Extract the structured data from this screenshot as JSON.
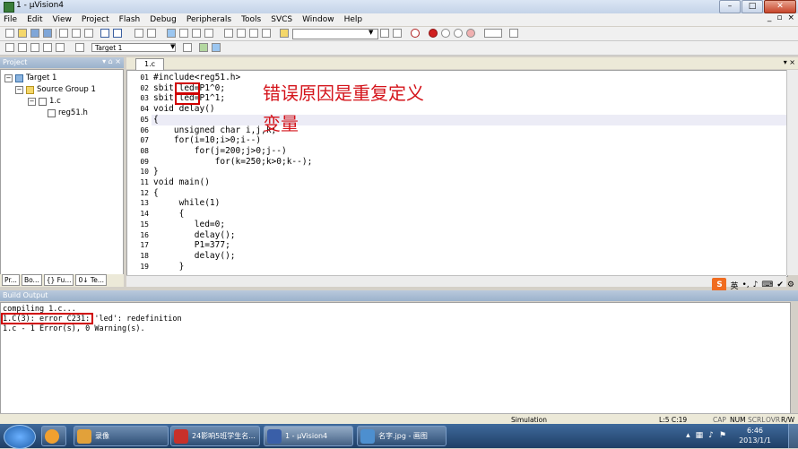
{
  "window": {
    "title": "1 - µVision4"
  },
  "menu": [
    "File",
    "Edit",
    "View",
    "Project",
    "Flash",
    "Debug",
    "Peripherals",
    "Tools",
    "SVCS",
    "Window",
    "Help"
  ],
  "toolbar": {
    "target": "Target 1"
  },
  "project_panel": {
    "title": "Project",
    "tree": {
      "target": "Target 1",
      "group": "Source Group 1",
      "file": "1.c",
      "header": "reg51.h"
    },
    "tabs": [
      "Pr...",
      "Bo...",
      "{} Fu...",
      "0↓ Te..."
    ]
  },
  "editor": {
    "tab": "1.c",
    "lines": [
      {
        "n": "01",
        "t": "#include<reg51.h>"
      },
      {
        "n": "02",
        "t": "sbit led=P1^0;"
      },
      {
        "n": "03",
        "t": "sbit led=P1^1;"
      },
      {
        "n": "04",
        "t": "void delay()"
      },
      {
        "n": "05",
        "t": "{"
      },
      {
        "n": "06",
        "t": "    unsigned char i,j,k;"
      },
      {
        "n": "07",
        "t": "    for(i=10;i>0;i--)"
      },
      {
        "n": "08",
        "t": "        for(j=200;j>0;j--)"
      },
      {
        "n": "09",
        "t": "            for(k=250;k>0;k--);"
      },
      {
        "n": "10",
        "t": "}"
      },
      {
        "n": "11",
        "t": "void main()"
      },
      {
        "n": "12",
        "t": "{"
      },
      {
        "n": "13",
        "t": "     while(1)"
      },
      {
        "n": "14",
        "t": "     {"
      },
      {
        "n": "15",
        "t": "        led=0;"
      },
      {
        "n": "16",
        "t": "        delay();"
      },
      {
        "n": "17",
        "t": "        P1=377;"
      },
      {
        "n": "18",
        "t": "        delay();"
      },
      {
        "n": "19",
        "t": "     }"
      }
    ],
    "annotation_line1": "错误原因是重复定义",
    "annotation_line2": "变量"
  },
  "build_output": {
    "title": "Build Output",
    "lines": [
      "compiling 1.c...",
      "1.C(3): error C231: 'led': redefinition",
      "1.c - 1 Error(s), 0 Warning(s)."
    ]
  },
  "ime": {
    "logo": "S",
    "lang": "英"
  },
  "status": {
    "mode": "Simulation",
    "position": "L:5 C:19",
    "flags": [
      "CAP",
      "NUM",
      "SCRL",
      "OVR",
      "R/W"
    ]
  },
  "taskbar": {
    "items": [
      {
        "label": "录像",
        "color": "#e2a13a"
      },
      {
        "label": "24影响5班学生名...",
        "color": "#c8302a"
      },
      {
        "label": "1 - µVision4",
        "color": "#3a7d3a"
      },
      {
        "label": "名字.jpg - 画图",
        "color": "#4d8fcf"
      }
    ],
    "time": "6:46",
    "date": "2013/1/1"
  }
}
